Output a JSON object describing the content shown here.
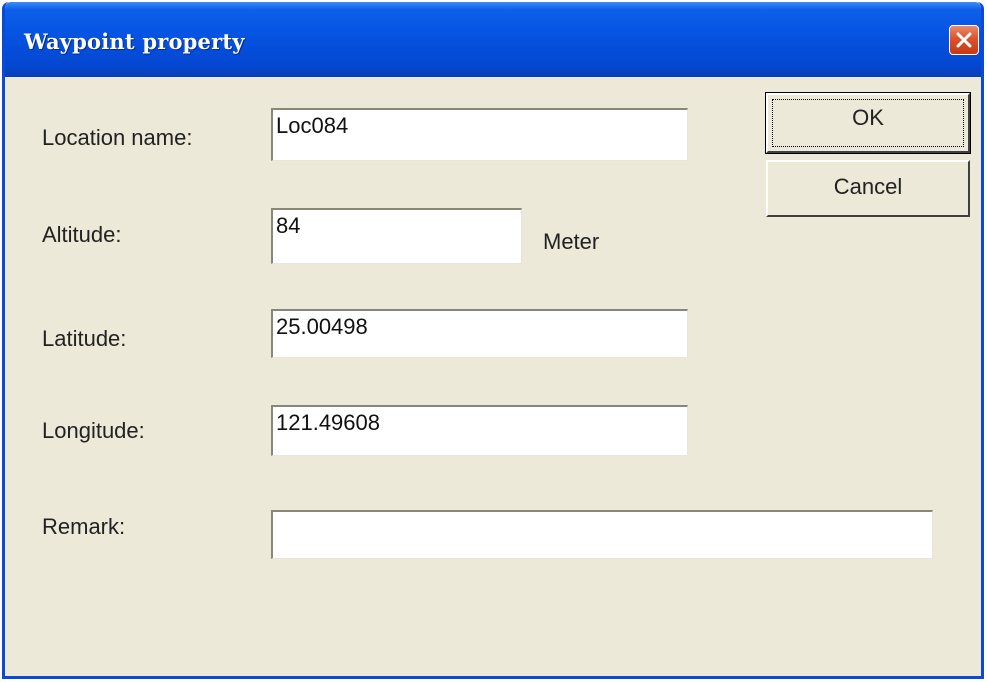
{
  "window": {
    "title": "Waypoint property",
    "colors": {
      "titlebar": "#0553e1",
      "body": "#ece9d8",
      "close_button": "#d9532c"
    }
  },
  "form": {
    "location_name": {
      "label": "Location name:",
      "value": "Loc084"
    },
    "altitude": {
      "label": "Altitude:",
      "value": "84",
      "unit": "Meter"
    },
    "latitude": {
      "label": "Latitude:",
      "value": "25.00498"
    },
    "longitude": {
      "label": "Longitude:",
      "value": "121.49608"
    },
    "remark": {
      "label": "Remark:",
      "value": ""
    }
  },
  "buttons": {
    "ok": "OK",
    "cancel": "Cancel"
  },
  "icons": {
    "close": "close-icon"
  }
}
